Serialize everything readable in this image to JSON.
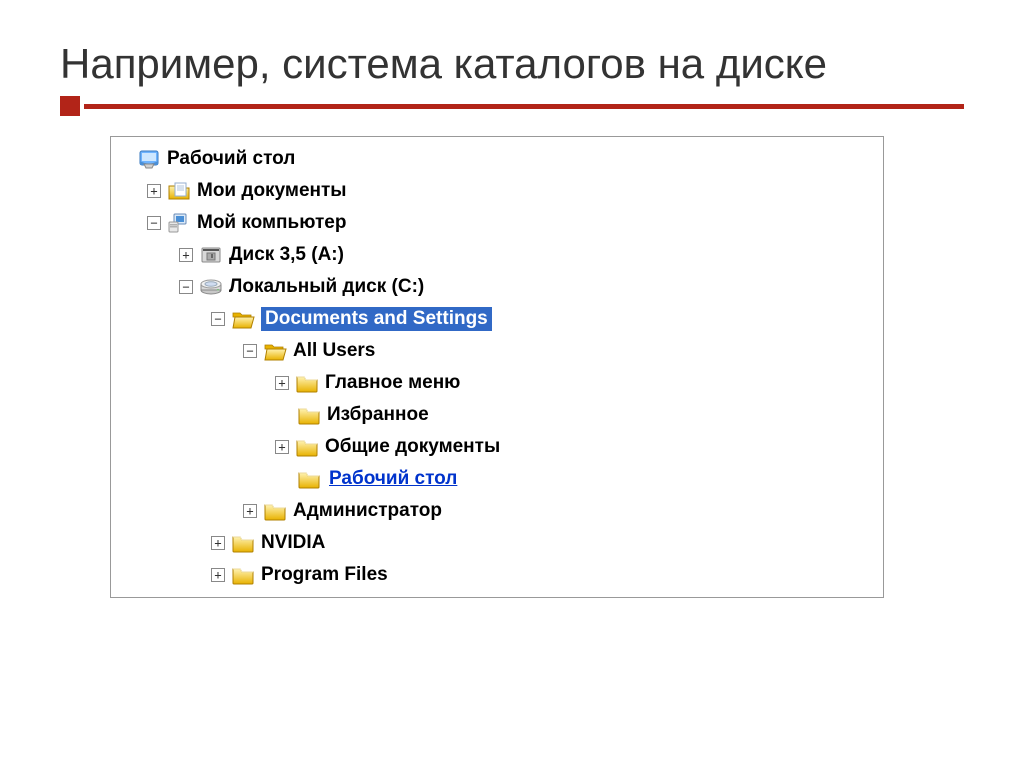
{
  "title": "Например, система каталогов на диске",
  "tree": {
    "desktop": {
      "label": "Рабочий стол"
    },
    "mydocs": {
      "label": "Мои документы"
    },
    "mycomputer": {
      "label": "Мой компьютер"
    },
    "floppy": {
      "label": "Диск 3,5 (A:)"
    },
    "localdisk": {
      "label": "Локальный диск (C:)"
    },
    "docsettings": {
      "label": "Documents and Settings"
    },
    "allusers": {
      "label": "All Users"
    },
    "startmenu": {
      "label": "Главное меню"
    },
    "favorites": {
      "label": "Избранное"
    },
    "shareddocs": {
      "label": "Общие документы"
    },
    "desktoplink": {
      "label": "Рабочий стол"
    },
    "administrator": {
      "label": "Администратор"
    },
    "nvidia": {
      "label": "NVIDIA"
    },
    "programfiles": {
      "label": "Program Files"
    }
  },
  "toggle": {
    "plus": "+",
    "minus": "−"
  }
}
